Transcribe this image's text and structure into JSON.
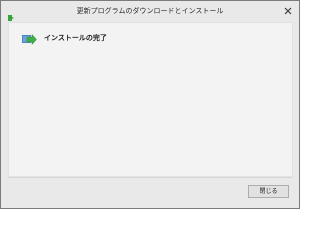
{
  "window": {
    "title": "更新プログラムのダウンロードとインストール",
    "icon": "windows-update-icon"
  },
  "titlebar": {
    "close_icon": "close-icon"
  },
  "main": {
    "heading": "インストールの完了",
    "heading_icon": "update-arrow-icon",
    "heading_icon_color": "#3fae49"
  },
  "footer": {
    "close_button_label": "閉じる"
  }
}
